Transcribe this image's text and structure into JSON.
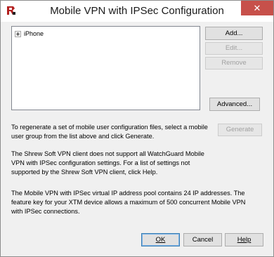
{
  "window": {
    "title": "Mobile VPN with IPSec Configuration",
    "close_glyph": "✕",
    "icon": "watchguard-logo-icon",
    "accent_color": "#c7504a"
  },
  "tree": {
    "items": [
      {
        "label": "iPhone",
        "expanded": false
      }
    ]
  },
  "buttons": {
    "add": "Add...",
    "edit": "Edit...",
    "remove": "Remove",
    "advanced": "Advanced...",
    "generate": "Generate",
    "ok": "OK",
    "cancel": "Cancel",
    "help": "Help"
  },
  "text": {
    "regenerate": [
      "To regenerate a set of mobile user configuration files, select a mobile",
      "user group from the list above and click Generate."
    ],
    "shrew": [
      "The Shrew Soft VPN client does not support all WatchGuard Mobile",
      "VPN with IPSec configuration settings. For a list of settings not",
      "supported by the Shrew Soft VPN client, click Help."
    ],
    "pool": [
      "The Mobile VPN with IPSec virtual IP address pool contains 24 IP addresses. The",
      "feature key for your XTM device allows a maximum of 500 concurrent Mobile VPN",
      "with IPSec connections."
    ]
  }
}
